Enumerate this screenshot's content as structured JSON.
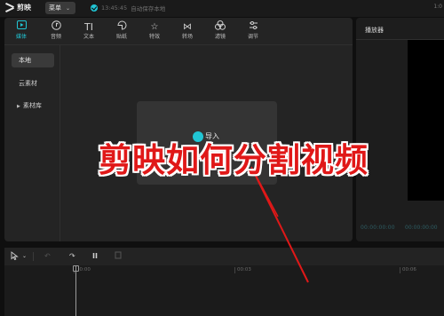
{
  "topbar": {
    "logo_text": "剪映",
    "menu_label": "菜单",
    "save_time": "13:45:45",
    "save_text": "自动保存本地",
    "right_text": "1:0"
  },
  "media": {
    "tabs": [
      {
        "label": "媒体",
        "icon": "media-icon",
        "active": true
      },
      {
        "label": "音频",
        "icon": "audio-icon"
      },
      {
        "label": "文本",
        "icon": "text-icon"
      },
      {
        "label": "贴纸",
        "icon": "sticker-icon"
      },
      {
        "label": "特效",
        "icon": "effects-icon"
      },
      {
        "label": "转场",
        "icon": "transition-icon"
      },
      {
        "label": "滤镜",
        "icon": "filter-icon"
      },
      {
        "label": "调节",
        "icon": "adjust-icon"
      }
    ],
    "sidebar": [
      {
        "label": "本地",
        "active": true
      },
      {
        "label": "云素材"
      },
      {
        "label": "素材库",
        "expandable": true
      }
    ],
    "import_label": "导入"
  },
  "player": {
    "title": "播放器",
    "current_time": "00:00:00:00",
    "total_time": "00:00:00:00"
  },
  "timeline": {
    "ruler": [
      "00:00",
      "00:03",
      "00:06"
    ]
  },
  "overlay": {
    "caption": "剪映如何分割视频",
    "color": "#e01818"
  },
  "colors": {
    "accent": "#21c5d4",
    "background": "#0f0f0f",
    "panel": "#242424"
  }
}
